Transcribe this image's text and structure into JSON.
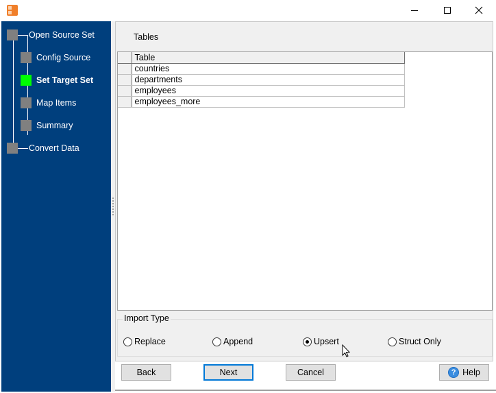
{
  "window": {
    "app_icon": "app-icon",
    "controls": {
      "minimize": "minimize-icon",
      "maximize": "maximize-icon",
      "close": "close-icon"
    }
  },
  "sidebar": {
    "steps": [
      {
        "label": "Open Source Set",
        "state": "done"
      },
      {
        "label": "Config Source",
        "state": "done"
      },
      {
        "label": "Set Target Set",
        "state": "active"
      },
      {
        "label": "Map Items",
        "state": "pending"
      },
      {
        "label": "Summary",
        "state": "pending"
      },
      {
        "label": "Convert Data",
        "state": "pending"
      }
    ],
    "active_color": "#00ff00",
    "inactive_color": "#808080",
    "background_color": "#003f7d"
  },
  "main": {
    "section_title": "Tables",
    "table": {
      "columns": [
        "Table"
      ],
      "rows": [
        "countries",
        "departments",
        "employees",
        "employees_more"
      ]
    },
    "import_type": {
      "label": "Import Type",
      "options": [
        "Replace",
        "Append",
        "Upsert",
        "Struct Only"
      ],
      "selected": "Upsert"
    }
  },
  "buttons": {
    "back": "Back",
    "next": "Next",
    "cancel": "Cancel",
    "help": "Help",
    "help_icon_glyph": "?"
  }
}
